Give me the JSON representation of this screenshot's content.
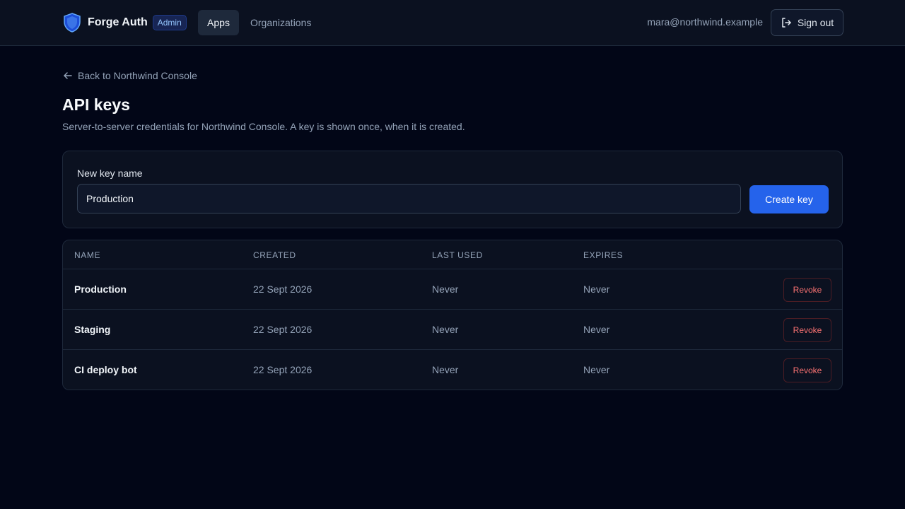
{
  "header": {
    "brand_name": "Forge Auth",
    "admin_badge": "Admin",
    "nav": {
      "apps": "Apps",
      "organizations": "Organizations"
    },
    "user_email": "mara@northwind.example",
    "sign_out_label": "Sign out"
  },
  "back_link": "Back to Northwind Console",
  "page": {
    "title": "API keys",
    "description": "Server-to-server credentials for Northwind Console. A key is shown once, when it is created."
  },
  "create_form": {
    "label": "New key name",
    "input_value": "Production",
    "button_label": "Create key"
  },
  "table": {
    "columns": [
      "NAME",
      "CREATED",
      "LAST USED",
      "EXPIRES"
    ],
    "rows": [
      {
        "name": "Production",
        "created": "22 Sept 2026",
        "last_used": "Never",
        "expires": "Never",
        "action": "Revoke"
      },
      {
        "name": "Staging",
        "created": "22 Sept 2026",
        "last_used": "Never",
        "expires": "Never",
        "action": "Revoke"
      },
      {
        "name": "CI deploy bot",
        "created": "22 Sept 2026",
        "last_used": "Never",
        "expires": "Never",
        "action": "Revoke"
      }
    ]
  },
  "icons": {
    "brand": "shield-icon",
    "sign_out": "sign-out-icon",
    "back": "arrow-left-icon"
  },
  "colors": {
    "background": "#020617",
    "primary": "#2563eb",
    "danger": "#f87171",
    "badge": "#93c5fd"
  }
}
